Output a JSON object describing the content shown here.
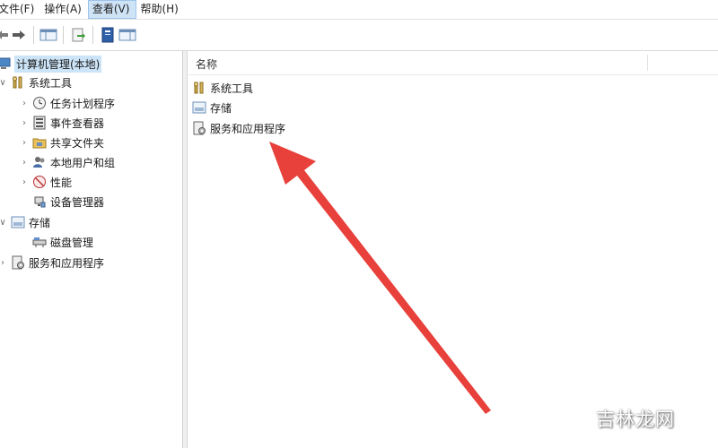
{
  "menu": [
    "文件(F)",
    "操作(A)",
    "查看(V)",
    "帮助(H)"
  ],
  "tree": {
    "root": "计算机管理(本地)",
    "system_tools": "系统工具",
    "task_scheduler": "任务计划程序",
    "event_viewer": "事件查看器",
    "shared_folders": "共享文件夹",
    "local_users": "本地用户和组",
    "performance": "性能",
    "device_manager": "设备管理器",
    "storage": "存储",
    "disk_management": "磁盘管理",
    "services_apps": "服务和应用程序"
  },
  "list": {
    "column_name": "名称",
    "items": [
      "系统工具",
      "存储",
      "服务和应用程序"
    ]
  },
  "watermark": "吉林龙网",
  "colors": {
    "arrow": "#e8403a",
    "selection": "#cce4f7",
    "active_menu": "#cfe3f7"
  }
}
